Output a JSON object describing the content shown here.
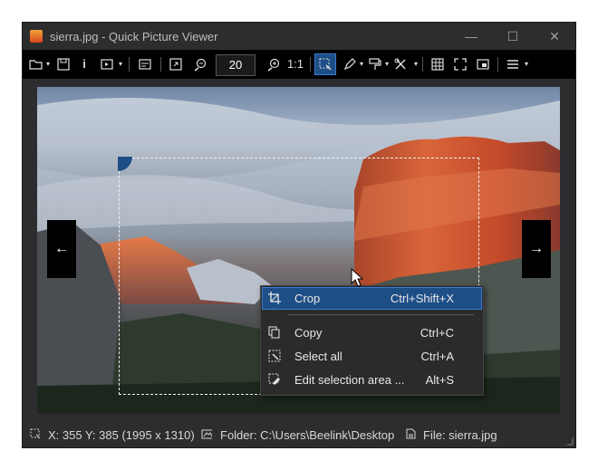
{
  "window": {
    "title": "sierra.jpg - Quick Picture Viewer",
    "minimize": "—",
    "maximize": "☐",
    "close": "✕"
  },
  "toolbar": {
    "info_label": "i",
    "zoom_value": "20",
    "actual_size_label": "1:1",
    "icons": [
      "open-folder-icon",
      "save-icon",
      "info-icon",
      "slideshow-icon",
      "properties-icon",
      "fit-icon",
      "zoom-out-icon",
      "zoom-in-icon",
      "select-icon",
      "draw-icon",
      "paint-icon",
      "tools-icon",
      "grid-icon",
      "fullscreen-icon",
      "picture-in-picture-icon",
      "menu-icon"
    ]
  },
  "navigation": {
    "prev": "←",
    "next": "→"
  },
  "context_menu": {
    "items": [
      {
        "label": "Crop",
        "shortcut": "Ctrl+Shift+X",
        "icon": "crop-icon",
        "highlighted": true
      },
      {
        "label": "Copy",
        "shortcut": "Ctrl+C",
        "icon": "copy-icon",
        "highlighted": false
      },
      {
        "label": "Select all",
        "shortcut": "Ctrl+A",
        "icon": "select-all-icon",
        "highlighted": false
      },
      {
        "label": "Edit selection area ...",
        "shortcut": "Alt+S",
        "icon": "edit-selection-icon",
        "highlighted": false
      }
    ]
  },
  "status": {
    "coords": "X: 355 Y: 385 (1995 x 1310)",
    "folder": "Folder: C:\\Users\\Beelink\\Desktop",
    "file": "File: sierra.jpg"
  },
  "colors": {
    "accent": "#1e4e86",
    "toolbar_bg": "#000000",
    "window_bg": "#2d2d30"
  }
}
